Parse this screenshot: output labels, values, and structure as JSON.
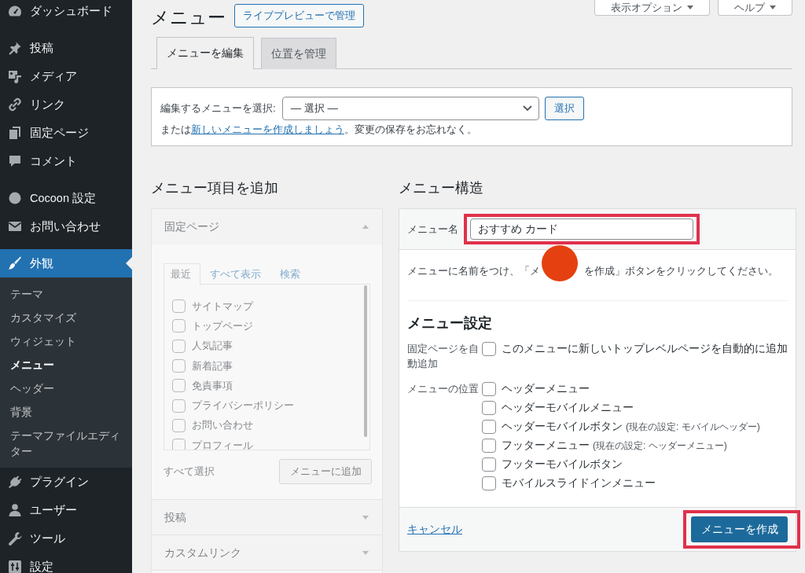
{
  "sidebar": {
    "groups": [
      [
        {
          "label": "ダッシュボード",
          "selected": false,
          "expanded": false
        }
      ],
      [
        {
          "label": "投稿",
          "selected": false,
          "expanded": false
        },
        {
          "label": "メディア",
          "selected": false,
          "expanded": false
        },
        {
          "label": "リンク",
          "selected": false,
          "expanded": false
        },
        {
          "label": "固定ページ",
          "selected": false,
          "expanded": false
        },
        {
          "label": "コメント",
          "selected": false,
          "expanded": false
        }
      ],
      [
        {
          "label": "Cocoon 設定",
          "selected": false,
          "expanded": false
        },
        {
          "label": "お問い合わせ",
          "selected": false,
          "expanded": false
        }
      ],
      [
        {
          "label": "外観",
          "selected": true,
          "expanded": true,
          "children": [
            {
              "label": "テーマ",
              "selected": false
            },
            {
              "label": "カスタマイズ",
              "selected": false
            },
            {
              "label": "ウィジェット",
              "selected": false
            },
            {
              "label": "メニュー",
              "selected": true
            },
            {
              "label": "ヘッダー",
              "selected": false
            },
            {
              "label": "背景",
              "selected": false
            },
            {
              "label": "テーマファイルエディター",
              "selected": false
            }
          ]
        },
        {
          "label": "プラグイン",
          "selected": false,
          "expanded": false
        },
        {
          "label": "ユーザー",
          "selected": false,
          "expanded": false
        },
        {
          "label": "ツール",
          "selected": false,
          "expanded": false
        },
        {
          "label": "設定",
          "selected": false,
          "expanded": false
        }
      ]
    ]
  },
  "header": {
    "title": "メニュー",
    "live_preview_button": "ライブプレビューで管理",
    "screen_buttons": [
      "表示オプション",
      "ヘルプ"
    ]
  },
  "tabs": [
    {
      "label": "メニューを編集",
      "selected": true
    },
    {
      "label": "位置を管理",
      "selected": false
    }
  ],
  "menu_picker": {
    "label": "編集するメニューを選択:",
    "value": "— 選択 —",
    "button": "選択",
    "note": {
      "before": "または",
      "link": "新しいメニューを作成しましょう",
      "after": "。変更の保存をお忘れなく。"
    }
  },
  "add_items": {
    "title": "メニュー項目を追加",
    "disabled": true,
    "sections": [
      {
        "title": "固定ページ",
        "expanded": true,
        "tabs": [
          {
            "label": "最近",
            "selected": true
          },
          {
            "label": "すべて表示",
            "selected": false
          },
          {
            "label": "検索",
            "selected": false
          }
        ],
        "items": [
          {
            "label": "サイトマップ",
            "checked": false
          },
          {
            "label": "トップページ",
            "checked": false
          },
          {
            "label": "人気記事",
            "checked": false
          },
          {
            "label": "新着記事",
            "checked": false
          },
          {
            "label": "免責事項",
            "checked": false
          },
          {
            "label": "プライバシーポリシー",
            "checked": false
          },
          {
            "label": "お問い合わせ",
            "checked": false
          },
          {
            "label": "プロフィール",
            "checked": false
          }
        ],
        "select_all": "すべて選択",
        "add_button": "メニューに追加"
      },
      {
        "title": "投稿",
        "expanded": false
      },
      {
        "title": "カスタムリンク",
        "expanded": false
      }
    ]
  },
  "structure": {
    "title": "メニュー構造",
    "name_field": {
      "label": "メニュー名",
      "value": "おすすめ カード",
      "highlighted": true
    },
    "tap_marker": true,
    "hint": [
      "メニューに名前をつけ、「メ",
      "を作成」ボタンをクリックしてください。"
    ],
    "settings": {
      "title": "メニュー設定",
      "rows": [
        {
          "label": "固定ページを自動追加",
          "options": [
            {
              "label": "このメニューに新しいトップレベルページを自動的に追加",
              "checked": false
            }
          ]
        },
        {
          "label": "メニューの位置",
          "options": [
            {
              "label": "ヘッダーメニュー",
              "checked": false
            },
            {
              "label": "ヘッダーモバイルメニュー",
              "checked": false
            },
            {
              "label": "ヘッダーモバイルボタン",
              "note": "(現在の設定: モバイルヘッダー)",
              "checked": false
            },
            {
              "label": "フッターメニュー",
              "note": "(現在の設定: ヘッダーメニュー)",
              "checked": false
            },
            {
              "label": "フッターモバイルボタン",
              "checked": false
            },
            {
              "label": "モバイルスライドインメニュー",
              "checked": false
            }
          ]
        }
      ]
    },
    "cancel_link": "キャンセル",
    "create_button": {
      "label": "メニューを作成",
      "highlighted": true
    }
  }
}
